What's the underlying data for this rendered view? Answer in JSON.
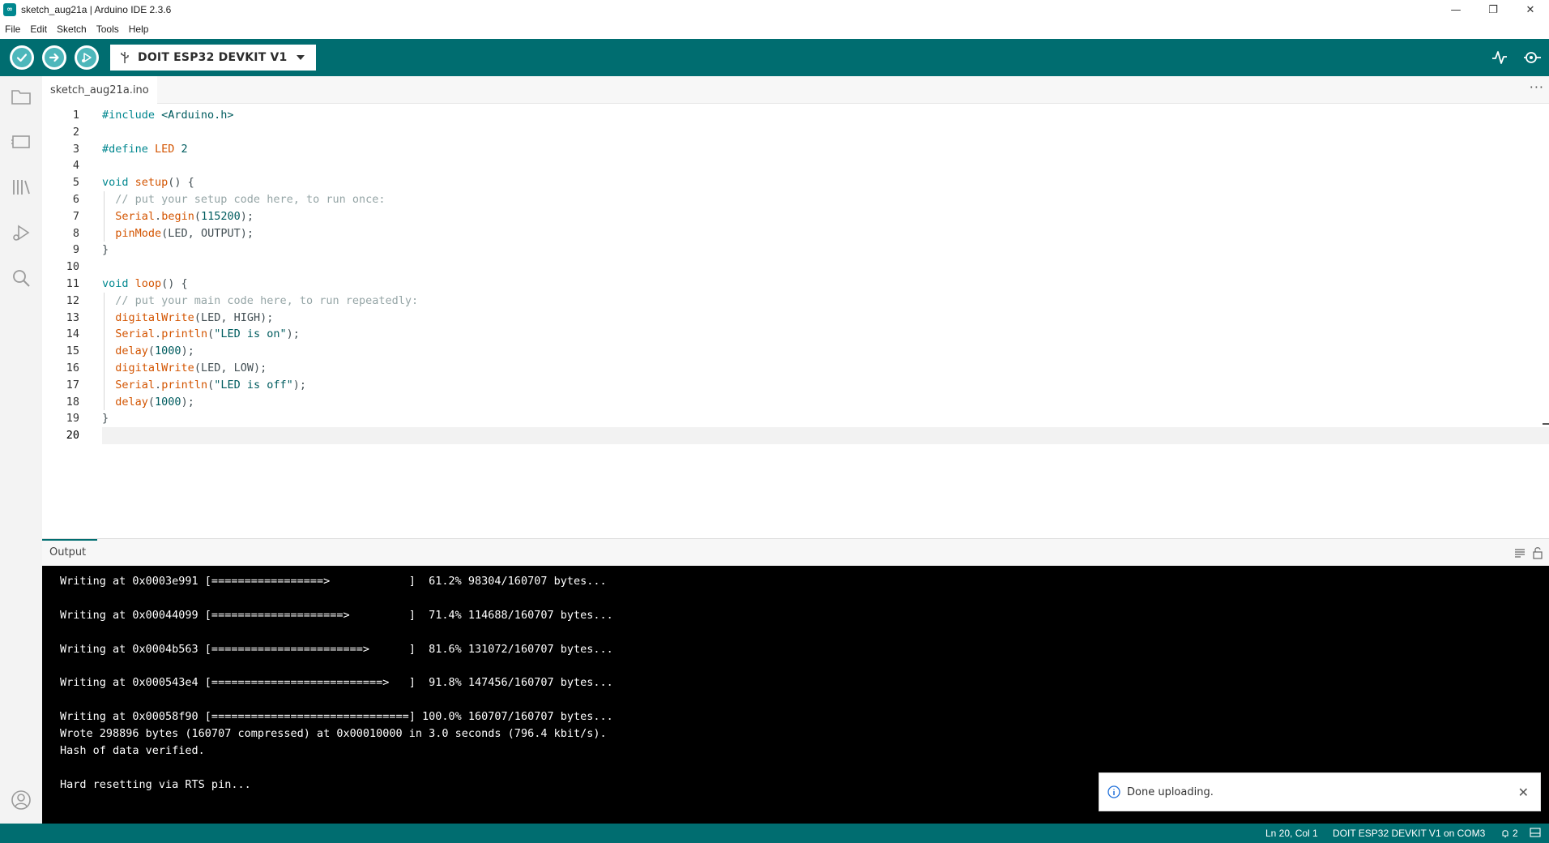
{
  "window": {
    "title": "sketch_aug21a | Arduino IDE 2.3.6",
    "controls": [
      "—",
      "❐",
      "✕"
    ]
  },
  "menu": [
    "File",
    "Edit",
    "Sketch",
    "Tools",
    "Help"
  ],
  "toolbar": {
    "verify_icon": "check-icon",
    "upload_icon": "arrow-right-icon",
    "debug_icon": "debug-icon",
    "board_label": "DOIT ESP32 DEVKIT V1",
    "serial_plotter_icon": "plotter-icon",
    "serial_monitor_icon": "monitor-icon"
  },
  "tabs": {
    "active": "sketch_aug21a.ino",
    "more": "···"
  },
  "editor": {
    "current_line": 20,
    "line_numbers": [
      "1",
      "2",
      "3",
      "4",
      "5",
      "6",
      "7",
      "8",
      "9",
      "10",
      "11",
      "12",
      "13",
      "14",
      "15",
      "16",
      "17",
      "18",
      "19",
      "20"
    ],
    "lines": [
      [
        {
          "t": "#include ",
          "c": "c-pre"
        },
        {
          "t": "<Arduino.h>",
          "c": "c-ang"
        }
      ],
      [],
      [
        {
          "t": "#define ",
          "c": "c-pre"
        },
        {
          "t": "LED ",
          "c": "c-fn"
        },
        {
          "t": "2",
          "c": "c-num"
        }
      ],
      [],
      [
        {
          "t": "void ",
          "c": "c-kw"
        },
        {
          "t": "setup",
          "c": "c-fn"
        },
        {
          "t": "() {",
          "c": "c-txt"
        }
      ],
      [
        {
          "t": "  // put your setup code here, to run once:",
          "c": "c-com"
        }
      ],
      [
        {
          "t": "  ",
          "c": "c-txt"
        },
        {
          "t": "Serial",
          "c": "c-fn"
        },
        {
          "t": ".",
          "c": "c-txt"
        },
        {
          "t": "begin",
          "c": "c-fn"
        },
        {
          "t": "(",
          "c": "c-txt"
        },
        {
          "t": "115200",
          "c": "c-num"
        },
        {
          "t": ");",
          "c": "c-txt"
        }
      ],
      [
        {
          "t": "  ",
          "c": "c-txt"
        },
        {
          "t": "pinMode",
          "c": "c-fn"
        },
        {
          "t": "(LED, OUTPUT);",
          "c": "c-txt"
        }
      ],
      [
        {
          "t": "}",
          "c": "c-txt"
        }
      ],
      [],
      [
        {
          "t": "void ",
          "c": "c-kw"
        },
        {
          "t": "loop",
          "c": "c-fn"
        },
        {
          "t": "() {",
          "c": "c-txt"
        }
      ],
      [
        {
          "t": "  // put your main code here, to run repeatedly:",
          "c": "c-com"
        }
      ],
      [
        {
          "t": "  ",
          "c": "c-txt"
        },
        {
          "t": "digitalWrite",
          "c": "c-fn"
        },
        {
          "t": "(LED, HIGH);",
          "c": "c-txt"
        }
      ],
      [
        {
          "t": "  ",
          "c": "c-txt"
        },
        {
          "t": "Serial",
          "c": "c-fn"
        },
        {
          "t": ".",
          "c": "c-txt"
        },
        {
          "t": "println",
          "c": "c-fn"
        },
        {
          "t": "(",
          "c": "c-txt"
        },
        {
          "t": "\"LED is on\"",
          "c": "c-str"
        },
        {
          "t": ");",
          "c": "c-txt"
        }
      ],
      [
        {
          "t": "  ",
          "c": "c-txt"
        },
        {
          "t": "delay",
          "c": "c-fn"
        },
        {
          "t": "(",
          "c": "c-txt"
        },
        {
          "t": "1000",
          "c": "c-num"
        },
        {
          "t": ");",
          "c": "c-txt"
        }
      ],
      [
        {
          "t": "  ",
          "c": "c-txt"
        },
        {
          "t": "digitalWrite",
          "c": "c-fn"
        },
        {
          "t": "(LED, LOW);",
          "c": "c-txt"
        }
      ],
      [
        {
          "t": "  ",
          "c": "c-txt"
        },
        {
          "t": "Serial",
          "c": "c-fn"
        },
        {
          "t": ".",
          "c": "c-txt"
        },
        {
          "t": "println",
          "c": "c-fn"
        },
        {
          "t": "(",
          "c": "c-txt"
        },
        {
          "t": "\"LED is off\"",
          "c": "c-str"
        },
        {
          "t": ");",
          "c": "c-txt"
        }
      ],
      [
        {
          "t": "  ",
          "c": "c-txt"
        },
        {
          "t": "delay",
          "c": "c-fn"
        },
        {
          "t": "(",
          "c": "c-txt"
        },
        {
          "t": "1000",
          "c": "c-num"
        },
        {
          "t": ");",
          "c": "c-txt"
        }
      ],
      [
        {
          "t": "}",
          "c": "c-txt"
        }
      ],
      []
    ]
  },
  "output": {
    "label": "Output",
    "lines": [
      "",
      "Writing at 0x0003e991 [=================>            ]  61.2% 98304/160707 bytes...",
      "",
      "Writing at 0x00044099 [====================>         ]  71.4% 114688/160707 bytes...",
      "",
      "Writing at 0x0004b563 [=======================>      ]  81.6% 131072/160707 bytes...",
      "",
      "Writing at 0x000543e4 [==========================>   ]  91.8% 147456/160707 bytes...",
      "",
      "Writing at 0x00058f90 [==============================] 100.0% 160707/160707 bytes...",
      "Wrote 298896 bytes (160707 compressed) at 0x00010000 in 3.0 seconds (796.4 kbit/s).",
      "Hash of data verified.",
      "",
      "Hard resetting via RTS pin..."
    ]
  },
  "notification": {
    "text": "Done uploading.",
    "icon": "info-icon",
    "close": "✕"
  },
  "status": {
    "position": "Ln 20, Col 1",
    "board": "DOIT ESP32 DEVKIT V1 on COM3",
    "notifications_count": "2"
  },
  "colors": {
    "accent": "#006d70",
    "console_bg": "#000000"
  }
}
